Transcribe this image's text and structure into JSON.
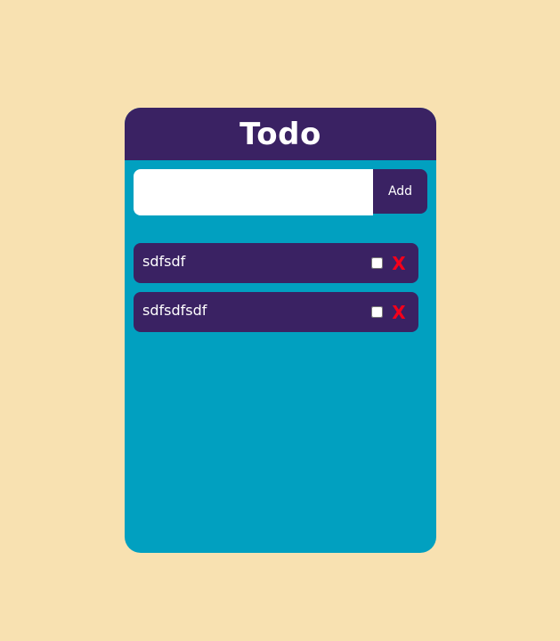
{
  "app": {
    "title": "Todo"
  },
  "add_form": {
    "input_value": "",
    "input_placeholder": "",
    "add_label": "Add"
  },
  "todos": [
    {
      "text": "sdfsdf",
      "checked": false,
      "delete_label": "X"
    },
    {
      "text": "sdfsdfsdf",
      "checked": false,
      "delete_label": "X"
    }
  ],
  "colors": {
    "page_background": "#f8e1b1",
    "card_background": "#01a0c0",
    "header_background": "#3a2263",
    "item_background": "#3a2263",
    "delete_color": "#f5001a"
  }
}
